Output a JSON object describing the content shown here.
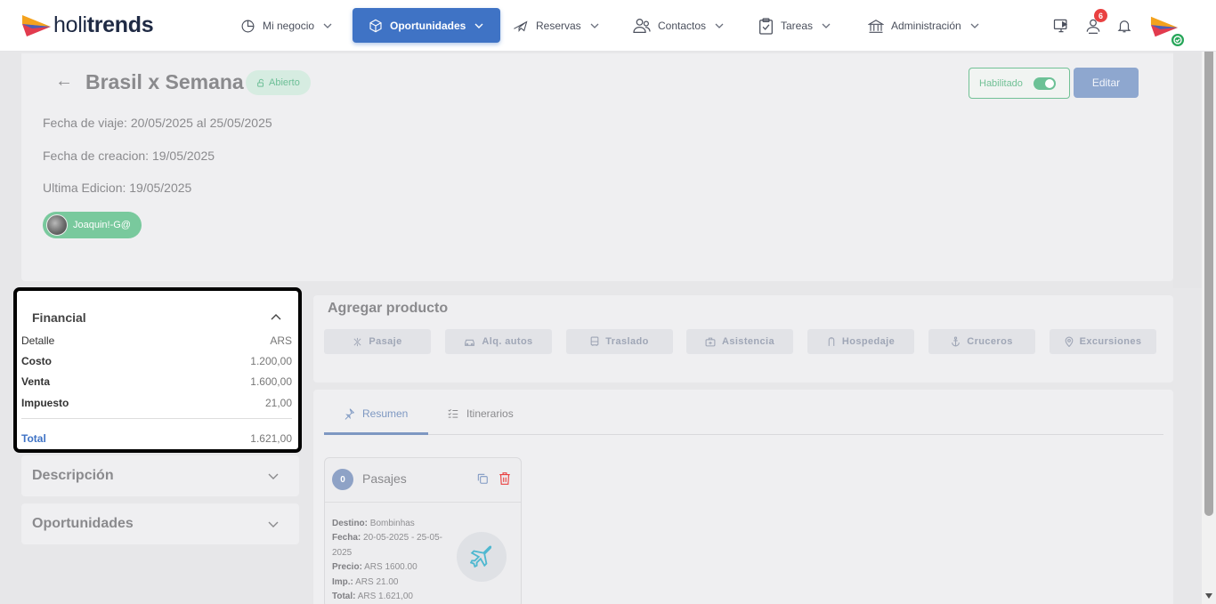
{
  "brand": {
    "logo_light": "holi",
    "logo_bold": "trends"
  },
  "nav": [
    {
      "label": "Mi negocio",
      "icon": "pie-chart-icon"
    },
    {
      "label": "Oportunidades",
      "icon": "cube-icon",
      "active": true
    },
    {
      "label": "Reservas",
      "icon": "plane-icon"
    },
    {
      "label": "Contactos",
      "icon": "users-icon"
    },
    {
      "label": "Tareas",
      "icon": "clipboard-icon"
    },
    {
      "label": "Administración",
      "icon": "bank-icon"
    }
  ],
  "top_icons": {
    "notifications_count": "6"
  },
  "header": {
    "title": "Brasil x Semana",
    "status": "Abierto",
    "travel_date": "Fecha de viaje: 20/05/2025 al 25/05/2025",
    "creation_date": "Fecha de creacion: 19/05/2025",
    "last_edit": "Ultima Edicion: 19/05/2025",
    "user": "Joaquin!-G@",
    "toggle_label": "Habilitado",
    "edit_label": "Editar"
  },
  "financial": {
    "title": "Financial",
    "rows": [
      {
        "label": "Detalle",
        "value": "ARS"
      },
      {
        "label": "Costo",
        "value": "1.200,00"
      },
      {
        "label": "Venta",
        "value": "1.600,00"
      },
      {
        "label": "Impuesto",
        "value": "21,00"
      }
    ],
    "total_label": "Total",
    "total_value": "1.621,00"
  },
  "accordions": {
    "descripcion": "Descripción",
    "oportunidades": "Oportunidades"
  },
  "products": {
    "title": "Agregar producto",
    "buttons": [
      "Pasaje",
      "Alq. autos",
      "Traslado",
      "Asistencia",
      "Hospedaje",
      "Cruceros",
      "Excursiones"
    ]
  },
  "tabs": {
    "resumen": "Resumen",
    "itinerarios": "Itinerarios"
  },
  "pasajes": {
    "count": "0",
    "title": "Pasajes",
    "destino_label": "Destino:",
    "destino": "Bombinhas",
    "fecha_label": "Fecha:",
    "fecha": "20-05-2025 - 25-05-2025",
    "precio_label": "Precio:",
    "precio": "ARS 1600.00",
    "imp_label": "Imp.:",
    "imp": "ARS 21.00",
    "total_label": "Total:",
    "total": "ARS 1.621,00"
  },
  "colors": {
    "primary": "#3f73c5",
    "success": "#6cc196",
    "danger": "#e94141"
  }
}
